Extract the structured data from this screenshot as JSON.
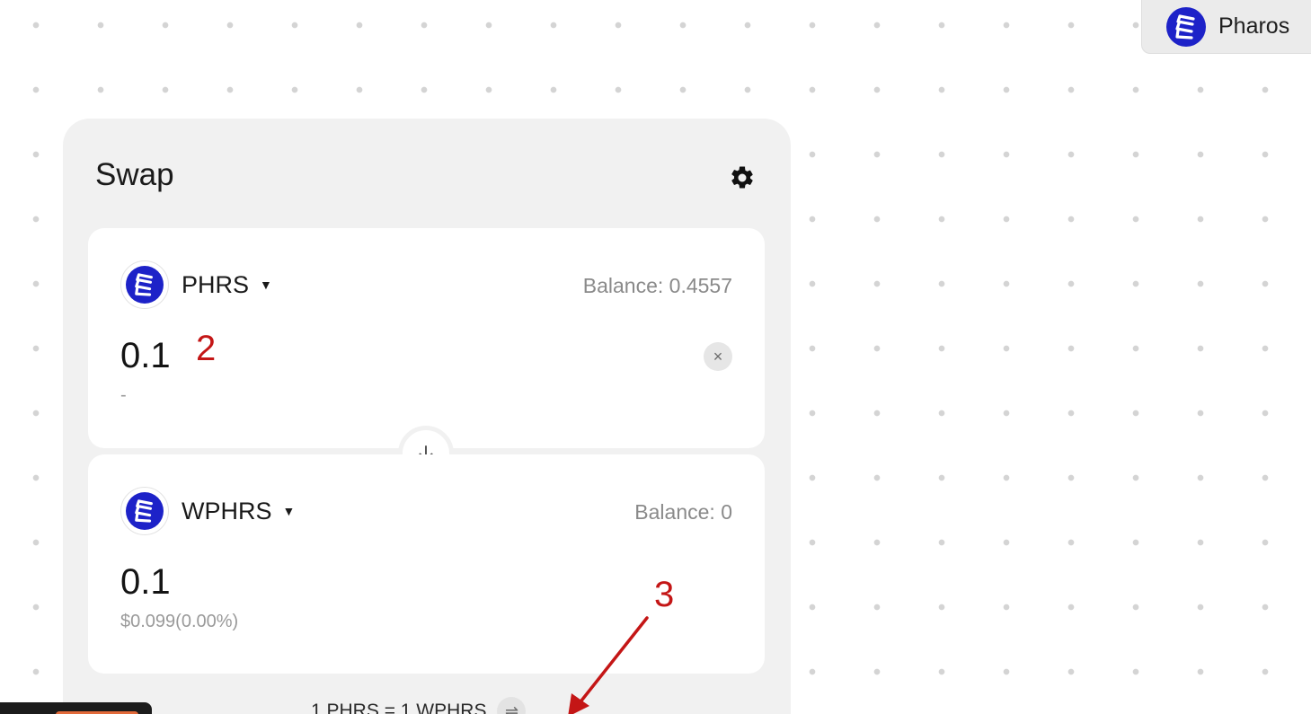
{
  "network": {
    "label": "Pharos",
    "icon": "pharos-logo-icon"
  },
  "swap": {
    "title": "Swap",
    "settings_icon": "gear-icon",
    "from": {
      "symbol": "PHRS",
      "balance": "Balance: 0.4557",
      "amount": "0.1",
      "sub_value": "-",
      "clear_icon": "×"
    },
    "flip_icon": "arrow-down-icon",
    "to": {
      "symbol": "WPHRS",
      "balance": "Balance: 0",
      "amount": "0.1",
      "sub_value": "$0.099(0.00%)"
    },
    "rate": "1 PHRS = 1 WPHRS",
    "rate_toggle_icon": "swap-arrows-icon"
  },
  "annotations": {
    "step_2": "2",
    "step_3": "3",
    "color": "#c41616"
  },
  "colors": {
    "brand_blue": "#1d22c8",
    "card_bg": "#f1f1f1"
  }
}
